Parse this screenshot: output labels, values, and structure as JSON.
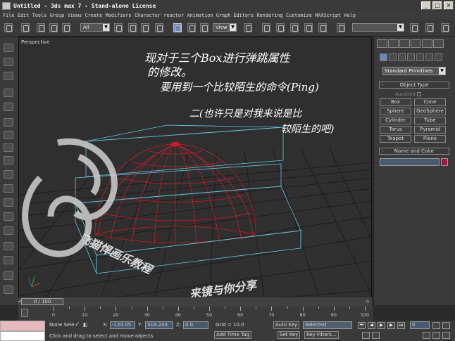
{
  "window": {
    "title": "Untitled - 3ds max 7  - Stand-alone License",
    "minimize": "_",
    "maximize": "□",
    "close": "×"
  },
  "menu": [
    "File",
    "Edit",
    "Tools",
    "Group",
    "Views",
    "Create",
    "Modifiers",
    "Character",
    "reactor",
    "Animation",
    "Graph Editors",
    "Rendering",
    "Customize",
    "MAXScript",
    "Help"
  ],
  "toolbar": {
    "selection_filter": "All",
    "ref_coord": "View"
  },
  "viewport": {
    "label": "Perspective",
    "annotation_lines": [
      "现对于三个Box进行弹跳属性",
      "的修改。",
      "要用到一个比较陌生的命令(Ping)",
      "二(也许只是对我来说是比",
      "较陌生的吧)"
    ],
    "watermark_line1": "飞猫悍画乐教程",
    "watermark_line2": "来镜与你分享"
  },
  "command_panel": {
    "primitive_type": "Standard Primitives",
    "object_type_header": "Object Type",
    "autogrid_label": "AutoGrid",
    "buttons": [
      "Box",
      "Cone",
      "Sphere",
      "GeoSphere",
      "Cylinder",
      "Tube",
      "Torus",
      "Pyramid",
      "Teapot",
      "Plane"
    ],
    "name_color_header": "Name and Color",
    "rollout_toggle": "-"
  },
  "timeline": {
    "slider_label": "0 / 100",
    "prev": "<",
    "next": ">",
    "ticks": [
      "0",
      "10",
      "20",
      "30",
      "40",
      "50",
      "60",
      "70",
      "80",
      "90",
      "100"
    ]
  },
  "status": {
    "selection": "None Sele",
    "x_label": "X:",
    "x_value": "-124.05",
    "y_label": "Y:",
    "y_value": "319.243",
    "z_label": "Z:",
    "z_value": "0.0",
    "grid": "Grid = 10.0",
    "auto_key": "Auto Key",
    "key_mode": "Selected",
    "set_key": "Set Key",
    "key_filters": "Key Filters...",
    "prompt": "Click and drag to select and move objects",
    "add_time_tag": "Add Time Tag",
    "frame_value": "0"
  },
  "colors": {
    "sphere_wireframe": "#cc1a2a",
    "box_wireframe": "#66c8dd",
    "grid": "#1a1a1a"
  }
}
